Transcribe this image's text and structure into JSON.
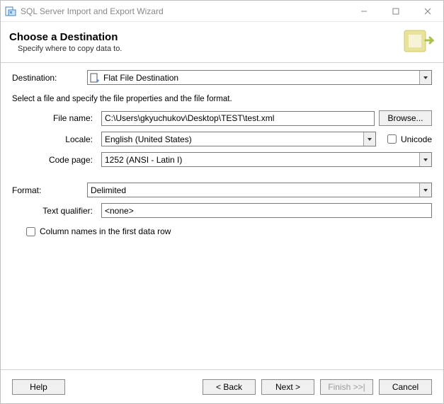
{
  "window": {
    "title": "SQL Server Import and Export Wizard"
  },
  "banner": {
    "title": "Choose a Destination",
    "subtitle": "Specify where to copy data to."
  },
  "labels": {
    "destination": "Destination:",
    "select_file_instr": "Select a file and specify the file properties and the file format.",
    "file_name": "File name:",
    "browse": "Browse...",
    "locale": "Locale:",
    "unicode": "Unicode",
    "code_page": "Code page:",
    "format": "Format:",
    "text_qualifier": "Text qualifier:",
    "column_names": "Column names in the first data row"
  },
  "values": {
    "destination": "Flat File Destination",
    "file_name": "C:\\Users\\gkyuchukov\\Desktop\\TEST\\test.xml",
    "locale": "English (United States)",
    "unicode_checked": false,
    "code_page": "1252  (ANSI - Latin I)",
    "format": "Delimited",
    "text_qualifier": "<none>",
    "column_names_checked": false
  },
  "footer": {
    "help": "Help",
    "back": "< Back",
    "next": "Next >",
    "finish": "Finish >>|",
    "cancel": "Cancel"
  }
}
